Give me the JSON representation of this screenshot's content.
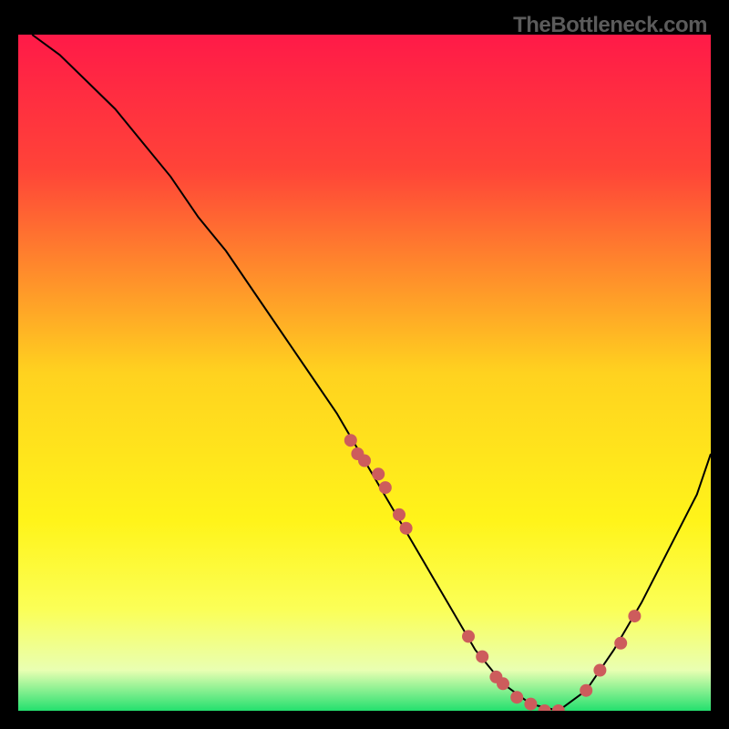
{
  "watermark": "TheBottleneck.com",
  "chart_data": {
    "type": "line",
    "xlim": [
      0,
      100
    ],
    "ylim": [
      0,
      100
    ],
    "title": "",
    "xlabel": "",
    "ylabel": "",
    "background_gradient": {
      "stops": [
        {
          "offset": 0,
          "color": "#ff1a48"
        },
        {
          "offset": 20,
          "color": "#ff4438"
        },
        {
          "offset": 50,
          "color": "#ffd21f"
        },
        {
          "offset": 72,
          "color": "#fff41a"
        },
        {
          "offset": 85,
          "color": "#fbff57"
        },
        {
          "offset": 94,
          "color": "#e9ffb2"
        },
        {
          "offset": 100,
          "color": "#24e06e"
        }
      ]
    },
    "series": [
      {
        "name": "curve",
        "style": "line",
        "color": "#000000",
        "x": [
          2,
          6,
          10,
          14,
          18,
          22,
          26,
          30,
          34,
          38,
          42,
          46,
          50,
          54,
          58,
          62,
          66,
          70,
          74,
          78,
          82,
          86,
          90,
          94,
          98,
          100
        ],
        "y": [
          100,
          97,
          93,
          89,
          84,
          79,
          73,
          68,
          62,
          56,
          50,
          44,
          37,
          30,
          23,
          16,
          9,
          4,
          1,
          0,
          3,
          9,
          16,
          24,
          32,
          38
        ]
      },
      {
        "name": "points",
        "style": "scatter",
        "color": "#cd5c5c",
        "x": [
          48,
          49,
          50,
          52,
          53,
          55,
          56,
          65,
          67,
          69,
          70,
          72,
          74,
          76,
          78,
          82,
          84,
          87,
          89
        ],
        "y": [
          40,
          38,
          37,
          35,
          33,
          29,
          27,
          11,
          8,
          5,
          4,
          2,
          1,
          0,
          0,
          3,
          6,
          10,
          14
        ]
      }
    ]
  }
}
